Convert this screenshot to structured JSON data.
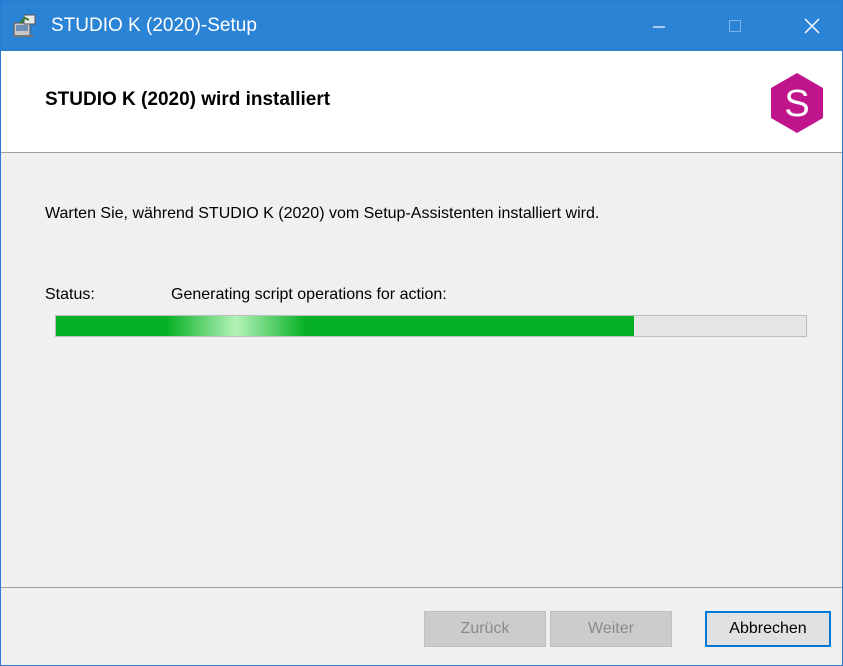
{
  "window": {
    "title": "STUDIO K (2020)-Setup",
    "icons": {
      "app": "installer-icon",
      "minimize": "minimize-icon",
      "maximize": "maximize-icon",
      "close": "close-icon"
    }
  },
  "header": {
    "title": "STUDIO K (2020) wird installiert",
    "logo_letter": "S",
    "logo_color": "#c0148c"
  },
  "content": {
    "description": "Warten Sie, während STUDIO K (2020) vom Setup-Assistenten installiert wird.",
    "status_label": "Status:",
    "status_value": "Generating script operations for action:",
    "progress_fraction": 0.77,
    "progress_color": "#06b025"
  },
  "footer": {
    "back_label": "Zurück",
    "next_label": "Weiter",
    "cancel_label": "Abbrechen"
  },
  "colors": {
    "titlebar": "#2b83d6",
    "focus_border": "#0078d7"
  }
}
